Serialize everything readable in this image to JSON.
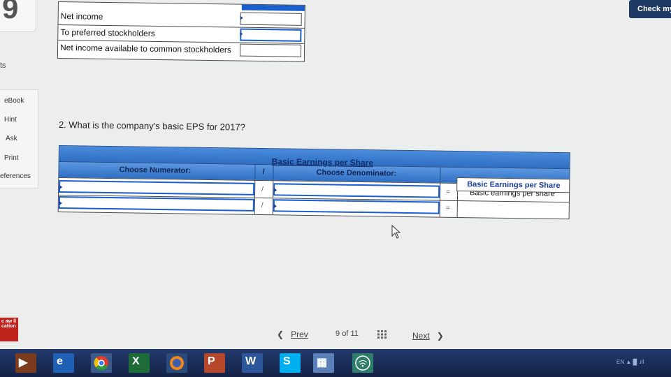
{
  "question_number": "9",
  "points_label": "ts",
  "side_panel": {
    "links": [
      "eBook",
      "Hint",
      "Ask",
      "Print",
      "eferences"
    ]
  },
  "check_button": "Check my",
  "top_table": {
    "rows": [
      {
        "label": "Net income"
      },
      {
        "label": "To preferred stockholders"
      },
      {
        "label": "Net income available to common stockholders"
      }
    ]
  },
  "question": "2. What is the company's basic EPS for 2017?",
  "eps_table": {
    "title": "Basic Earnings per Share",
    "numerator_header": "Choose Numerator:",
    "divide_symbol": "/",
    "denominator_header": "Choose Denominator:",
    "equals_symbol": "=",
    "result_header": "Basic Earnings per Share",
    "result_row_label": "Basic earnings per share"
  },
  "pager": {
    "prev": "Prev",
    "current": "9",
    "of_label": "of",
    "total": "11",
    "next": "Next"
  },
  "brand_logo_text": "c aw ll cation",
  "tray": {
    "language": "EN"
  }
}
